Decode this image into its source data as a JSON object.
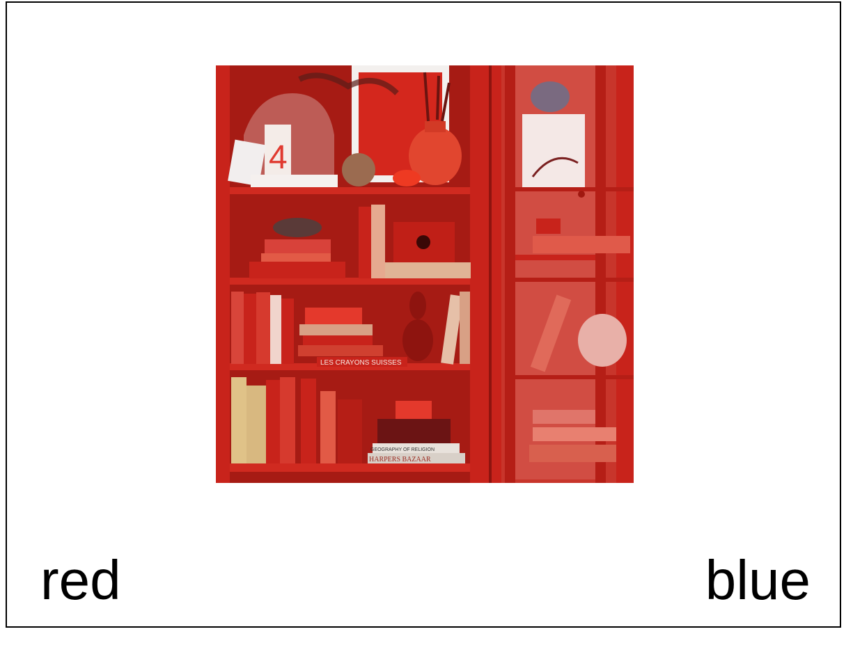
{
  "options": {
    "left_label": "red",
    "right_label": "blue"
  },
  "image": {
    "subject": "red-bookshelf-photo",
    "spine_text": "LES CRAYONS SUISSES",
    "book_titles": [
      "GEOGRAPHY OF RELIGION",
      "HARPERS BAZAAR"
    ],
    "big_number": "4",
    "colors": {
      "shelf": "#c8231b",
      "shelf_dark": "#8e140f",
      "shelf_back": "#b01e16",
      "background": "#ffffff",
      "text": "#000000"
    }
  }
}
